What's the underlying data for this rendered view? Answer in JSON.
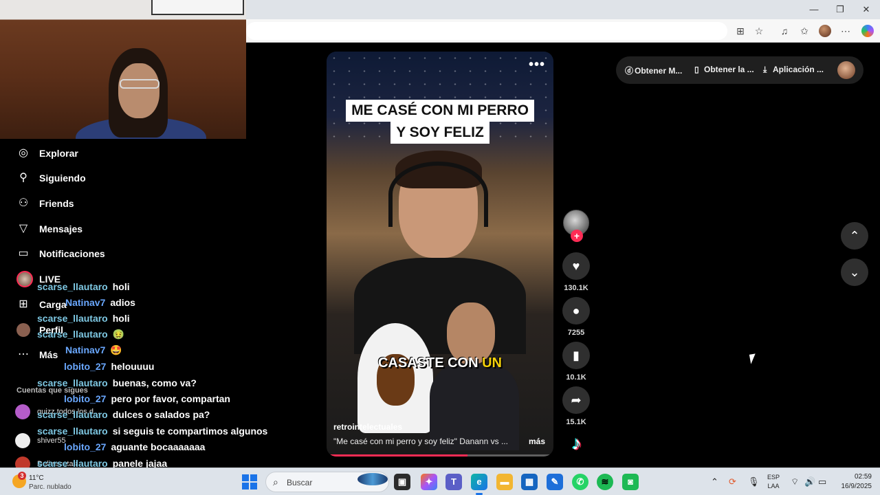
{
  "browser": {
    "minimize": "—",
    "restore": "❐",
    "close": "✕"
  },
  "sidebar": {
    "items": [
      {
        "label": "Explorar",
        "icon": "compass-icon"
      },
      {
        "label": "Siguiendo",
        "icon": "following-icon"
      },
      {
        "label": "Friends",
        "icon": "friends-icon"
      },
      {
        "label": "Mensajes",
        "icon": "messages-icon"
      },
      {
        "label": "Notificaciones",
        "icon": "notifications-icon"
      },
      {
        "label": "LIVE",
        "icon": "live-icon"
      },
      {
        "label": "Carga",
        "icon": "upload-icon"
      },
      {
        "label": "Perfil",
        "icon": "profile-icon"
      },
      {
        "label": "Más",
        "icon": "more-icon"
      }
    ],
    "following_title": "Cuentas que sigues",
    "accounts": [
      {
        "name": "quizz todos los d..."
      },
      {
        "name": "shiver55"
      },
      {
        "name": "Deli recetas"
      }
    ]
  },
  "chat": [
    {
      "user": "scarse_llautaro",
      "msg": "holi"
    },
    {
      "user": "Natinav7",
      "msg": "adios"
    },
    {
      "user": "scarse_llautaro",
      "msg": "holi"
    },
    {
      "user": "scarse_llautaro",
      "msg": "🤢"
    },
    {
      "user": "Natinav7",
      "msg": "🤩"
    },
    {
      "user": "lobito_27",
      "msg": "helouuuu"
    },
    {
      "user": "scarse_llautaro",
      "msg": "buenas, como va?"
    },
    {
      "user": "lobito_27",
      "msg": "pero por favor, compartan"
    },
    {
      "user": "scarse_llautaro",
      "msg": "dulces o salados pa?"
    },
    {
      "user": "scarse_llautaro",
      "msg": "si seguis te compartimos algunos"
    },
    {
      "user": "lobito_27",
      "msg": "aguante bocaaaaaaa"
    },
    {
      "user": "scarse_llautaro",
      "msg": "panele jajaa"
    },
    {
      "user": "scarse_llautaro",
      "msg": "🕺"
    }
  ],
  "video": {
    "headline_1": "ME CASÉ CON MI PERRO",
    "headline_2": "Y SOY FELIZ",
    "caption_a": "CASASTE CON ",
    "caption_b": "UN",
    "author": "retrointelectuales",
    "description": "\"Me casé con mi perro y soy feliz\" Danann vs ...",
    "more_link": "más",
    "more_menu": "•••",
    "progress": 0.62
  },
  "actions": {
    "likes": "130.1K",
    "comments": "7255",
    "saves": "10.1K",
    "shares": "15.1K"
  },
  "topbar": {
    "coins": "Obtener M...",
    "get_app": "Obtener la ...",
    "app": "Aplicación ..."
  },
  "taskbar": {
    "weather_badge": "3",
    "weather_temp": "11°C",
    "weather_desc": "Parc. nublado",
    "search_label": "Buscar",
    "lang_1": "ESP",
    "lang_2": "LAA",
    "time": "02:59",
    "date": "16/9/2025"
  }
}
